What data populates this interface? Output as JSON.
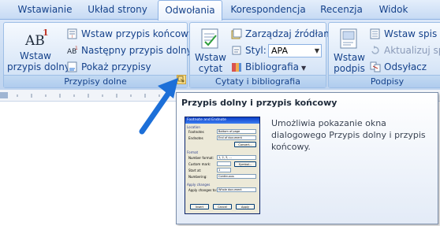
{
  "tabs": [
    {
      "label": "Wstawianie",
      "active": false
    },
    {
      "label": "Układ strony",
      "active": false
    },
    {
      "label": "Odwołania",
      "active": true
    },
    {
      "label": "Korespondencja",
      "active": false
    },
    {
      "label": "Recenzja",
      "active": false
    },
    {
      "label": "Widok",
      "active": false
    }
  ],
  "groups": {
    "footnotes": {
      "label": "Przypisy dolne",
      "insert_footnote": {
        "line1": "Wstaw",
        "line2": "przypis dolny",
        "icon": "footnote-ab1-icon"
      },
      "insert_endnote": "Wstaw przypis końcowy",
      "next_footnote": "Następny przypis dolny",
      "show_notes": "Pokaż przypisy"
    },
    "citations": {
      "label": "Cytaty i bibliografia",
      "insert_citation": {
        "line1": "Wstaw",
        "line2": "cytat"
      },
      "manage_sources": "Zarządzaj źródłami",
      "style_label": "Styl:",
      "style_value": "APA",
      "bibliography": "Bibliografia"
    },
    "captions": {
      "label": "Podpisy",
      "insert_caption": {
        "line1": "Wstaw",
        "line2": "podpis"
      },
      "insert_table_of_figures": "Wstaw spis ilu",
      "update_table": "Aktualizuj spis",
      "cross_reference": "Odsyłacz"
    }
  },
  "tooltip": {
    "title": "Przypis dolny i przypis końcowy",
    "description": "Umożliwia pokazanie okna dialogowego Przypis dolny i przypis końcowy."
  },
  "dialog_preview": {
    "title": "Footnote and Endnote",
    "location_label": "Location",
    "footnotes_option": "Footnotes",
    "footnotes_value": "Bottom of page",
    "endnotes_option": "Endnotes",
    "endnotes_value": "End of document",
    "convert_button": "Convert...",
    "format_label": "Format",
    "number_format_label": "Number format:",
    "number_format_value": "1, 2, 3, ...",
    "custom_mark_label": "Custom mark:",
    "symbol_button": "Symbol...",
    "start_at_label": "Start at:",
    "start_at_value": "1",
    "numbering_label": "Numbering:",
    "numbering_value": "Continuous",
    "apply_changes_label": "Apply changes",
    "apply_to_label": "Apply changes to:",
    "apply_to_value": "Whole document",
    "insert_button": "Insert",
    "cancel_button": "Cancel",
    "apply_button": "Apply"
  },
  "colors": {
    "tab_text": "#15428b",
    "ribbon_bg": "#c5d9f1",
    "arrow": "#1c6fd8"
  }
}
